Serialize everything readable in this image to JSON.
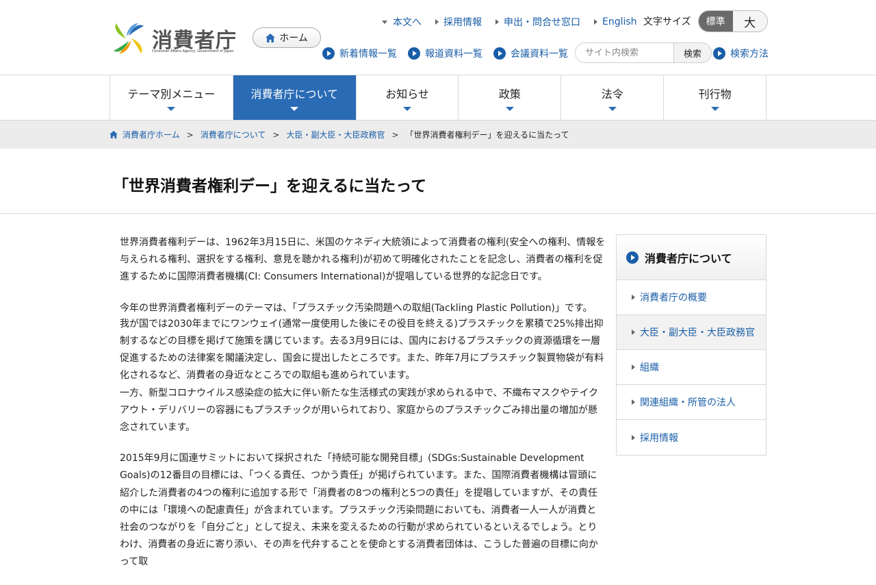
{
  "header": {
    "logo_text": "消費者庁",
    "logo_sub": "Consumer Affairs Agency, Government of Japan",
    "home_label": "ホーム",
    "util_links": [
      "本文へ",
      "採用情報",
      "申出・問合せ窓口",
      "English"
    ],
    "font_size_label": "文字サイズ",
    "font_size_standard": "標準",
    "font_size_large": "大",
    "quick_links": [
      "新着情報一覧",
      "報道資料一覧",
      "会議資料一覧"
    ],
    "search_placeholder": "サイト内検索",
    "search_button": "検索",
    "search_help": "検索方法"
  },
  "gnav": [
    "テーマ別メニュー",
    "消費者庁について",
    "お知らせ",
    "政策",
    "法令",
    "刊行物"
  ],
  "breadcrumb": {
    "items": [
      "消費者庁ホーム",
      "消費者庁について",
      "大臣・副大臣・大臣政務官"
    ],
    "current": "「世界消費者権利デー」を迎えるに当たって",
    "separator": ">"
  },
  "page_title": "「世界消費者権利デー」を迎えるに当たって",
  "body": {
    "p1": "世界消費者権利デーは、1962年3月15日に、米国のケネディ大統領によって消費者の権利(安全への権利、情報を与えられる権利、選択をする権利、意見を聴かれる権利)が初めて明確化されたことを記念し、消費者の権利を促進するために国際消費者機構(CI: Consumers International)が提唱している世界的な記念日です。",
    "p2a": "今年の世界消費者権利デーのテーマは、「プラスチック汚染問題への取組(Tackling Plastic Pollution)」です。",
    "p2b": "我が国では2030年までにワンウェイ(通常一度使用した後にその役目を終える)プラスチックを累積で25%排出抑制するなどの目標を掲げて施策を講じています。去る3月9日には、国内におけるプラスチックの資源循環を一層促進するための法律案を閣議決定し、国会に提出したところです。また、昨年7月にプラスチック製買物袋が有料化されるなど、消費者の身近なところでの取組も進められています。",
    "p2c": "一方、新型コロナウイルス感染症の拡大に伴い新たな生活様式の実践が求められる中で、不織布マスクやテイクアウト・デリバリーの容器にもプラスチックが用いられており、家庭からのプラスチックごみ排出量の増加が懸念されています。",
    "p3": "2015年9月に国連サミットにおいて採択された「持続可能な開発目標」(SDGs:Sustainable Development Goals)の12番目の目標には、「つくる責任、つかう責任」が掲げられています。また、国際消費者機構は冒頭に紹介した消費者の4つの権利に追加する形で「消費者の8つの権利と5つの責任」を提唱していますが、その責任の中には「環境への配慮責任」が含まれています。プラスチック汚染問題においても、消費者一人一人が消費と社会のつながりを「自分ごと」として捉え、未来を変えるための行動が求められているといえるでしょう。とりわけ、消費者の身近に寄り添い、その声を代弁することを使命とする消費者団体は、こうした普遍の目標に向かって取"
  },
  "side": {
    "title": "消費者庁について",
    "items": [
      "消費者庁の概要",
      "大臣・副大臣・大臣政務官",
      "組織",
      "関連組織・所管の法人",
      "採用情報"
    ]
  },
  "colors": {
    "accent": "#2a6bb5",
    "link": "#1a5ea8"
  }
}
